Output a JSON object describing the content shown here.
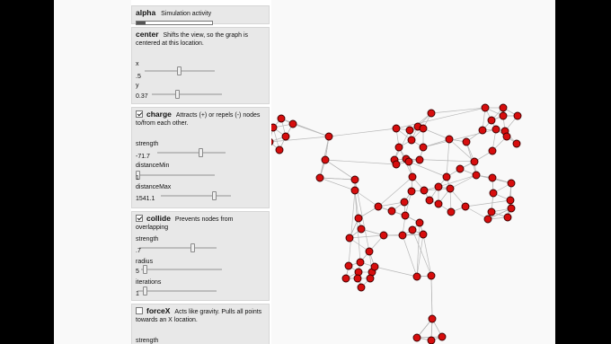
{
  "colors": {
    "node_fill": "#d70d0d",
    "node_stroke": "#3a0000",
    "link": "#b8b8b8"
  },
  "alpha": {
    "title": "alpha",
    "desc": "Simulation activity",
    "progress": 0.12
  },
  "center": {
    "title": "center",
    "desc": "Shifts the view, so the graph is centered at this location.",
    "x_label": "x",
    "x_value": ".5",
    "x_level": 0.5,
    "y_label": "y",
    "y_value": "0.37",
    "y_level": 0.37
  },
  "charge": {
    "enabled": true,
    "title": "charge",
    "desc": "Attracts (+) or repels (-) nodes to/from each other.",
    "strength_label": "strength",
    "strength_value": "-71.7",
    "strength_level": 0.64,
    "distanceMin_label": "distanceMin",
    "distanceMin_value": "1",
    "distanceMin_level": 0.03,
    "distanceMax_label": "distanceMax",
    "distanceMax_value": "1541.1",
    "distanceMax_level": 0.77
  },
  "collide": {
    "enabled": true,
    "title": "collide",
    "desc": "Prevents nodes from overlapping",
    "strength_label": "strength",
    "strength_value": ".7",
    "strength_level": 0.7,
    "radius_label": "radius",
    "radius_value": "5",
    "radius_level": 0.06,
    "iterations_label": "iterations",
    "iterations_value": "1",
    "iterations_level": 0.1
  },
  "forceX": {
    "enabled": false,
    "title": "forceX",
    "desc": "Acts like gravity. Pulls all points towards an X location.",
    "strength_label": "strength"
  }
}
